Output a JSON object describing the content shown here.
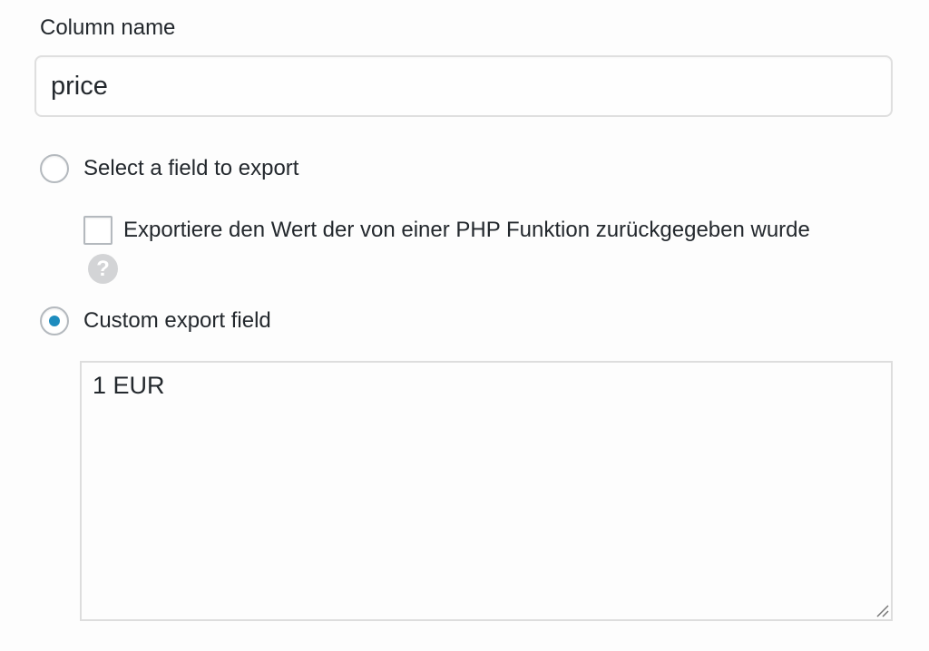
{
  "column": {
    "label": "Column name",
    "value": "price"
  },
  "options": {
    "select_field_label": "Select a field to export",
    "php_function_label": "Exportiere den Wert der von einer PHP Funktion zurückgegeben wurde",
    "help_glyph": "?",
    "custom_field_label": "Custom export field",
    "selected_option": "custom"
  },
  "custom_field": {
    "value": "1 EUR"
  },
  "icons": {
    "help": "help-icon",
    "resize": "resize-grip-icon"
  },
  "colors": {
    "accent": "#1e8cbe",
    "text": "#23282d",
    "border": "#dddddd"
  }
}
